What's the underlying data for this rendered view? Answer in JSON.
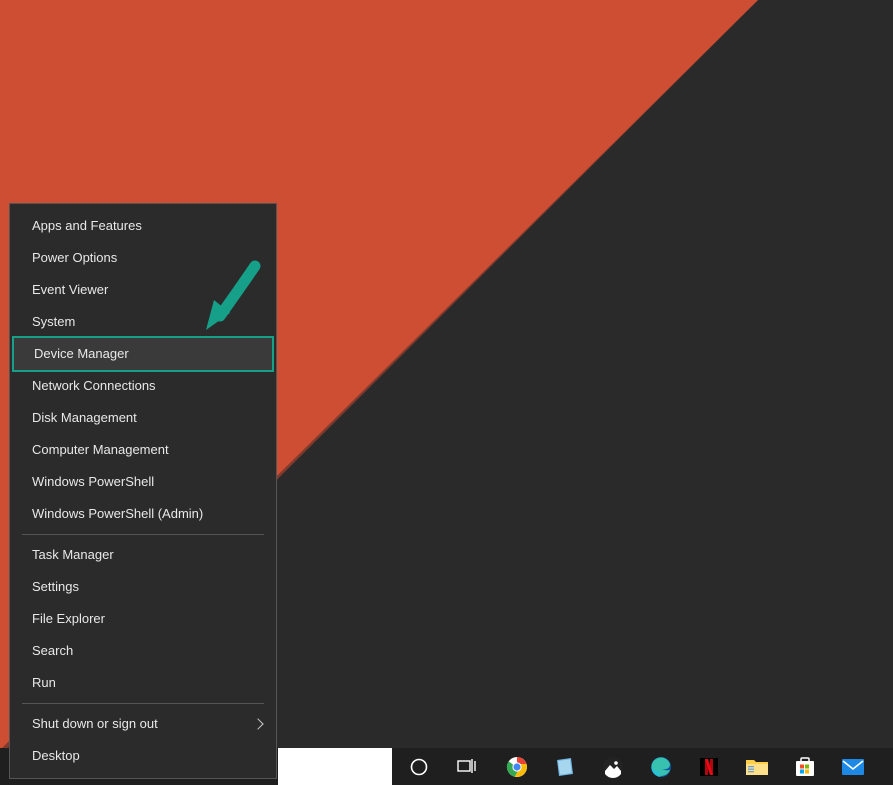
{
  "colors": {
    "wallpaper_orange": "#ec5a37",
    "wallpaper_dark": "#2a2a2a",
    "arrow": "#16a08a"
  },
  "menu": {
    "group1": [
      "Apps and Features",
      "Power Options",
      "Event Viewer",
      "System",
      "Device Manager",
      "Network Connections",
      "Disk Management",
      "Computer Management",
      "Windows PowerShell",
      "Windows PowerShell (Admin)"
    ],
    "group2": [
      "Task Manager",
      "Settings",
      "File Explorer",
      "Search",
      "Run"
    ],
    "group3": [
      "Shut down or sign out",
      "Desktop"
    ],
    "highlighted_index": 4,
    "submenu_label": "Shut down or sign out"
  },
  "taskbar": {
    "apps": [
      {
        "name": "chrome"
      },
      {
        "name": "notes"
      },
      {
        "name": "photos"
      },
      {
        "name": "edge"
      },
      {
        "name": "netflix"
      },
      {
        "name": "file-explorer"
      },
      {
        "name": "microsoft-store"
      },
      {
        "name": "mail"
      }
    ]
  }
}
